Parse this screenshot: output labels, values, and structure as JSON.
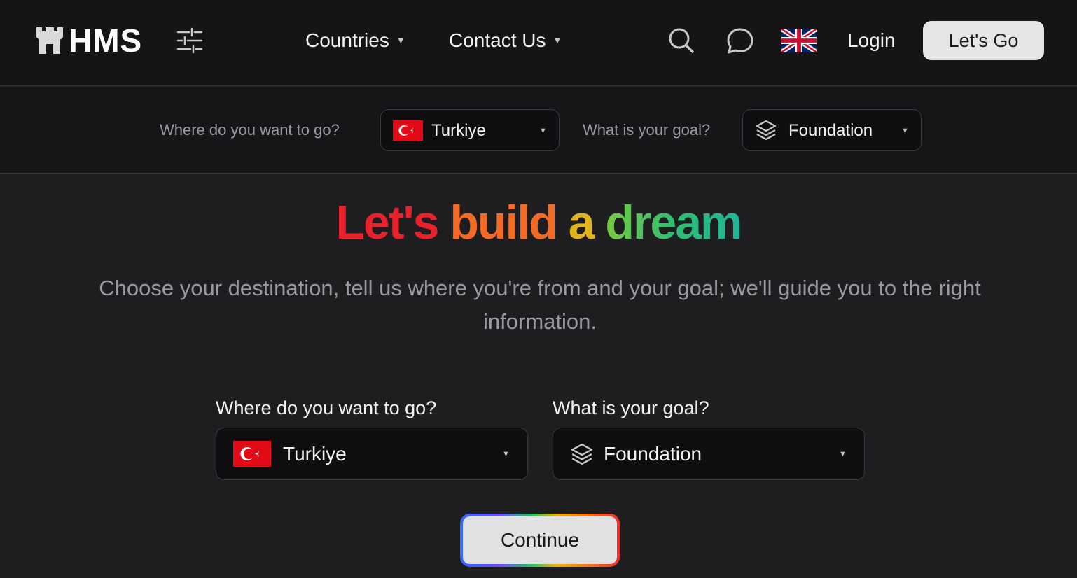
{
  "header": {
    "brand": "HMS",
    "nav": [
      {
        "label": "Countries"
      },
      {
        "label": "Contact Us"
      }
    ],
    "login_label": "Login",
    "cta_label": "Let's Go"
  },
  "subbar": {
    "destination_label": "Where do you want to go?",
    "destination_value": "Turkiye",
    "goal_label": "What is your goal?",
    "goal_value": "Foundation"
  },
  "hero": {
    "title_words": [
      "Let's",
      "build",
      "a",
      "dream"
    ],
    "title_colors": [
      "#e8212b",
      "#f46a24",
      "#e0b51c",
      "#2fbf71"
    ],
    "subtitle": "Choose your destination, tell us where you're from and your goal; we'll guide you to the right information."
  },
  "form": {
    "destination_label": "Where do you want to go?",
    "destination_value": "Turkiye",
    "goal_label": "What is your goal?",
    "goal_value": "Foundation",
    "submit_label": "Continue"
  },
  "icons": {
    "logo": "castle-icon",
    "filter": "sliders-icon",
    "search": "search-icon",
    "chat": "chat-bubble-icon",
    "language": "uk-flag-icon",
    "destination": "turkey-flag-icon",
    "goal": "layers-icon"
  }
}
